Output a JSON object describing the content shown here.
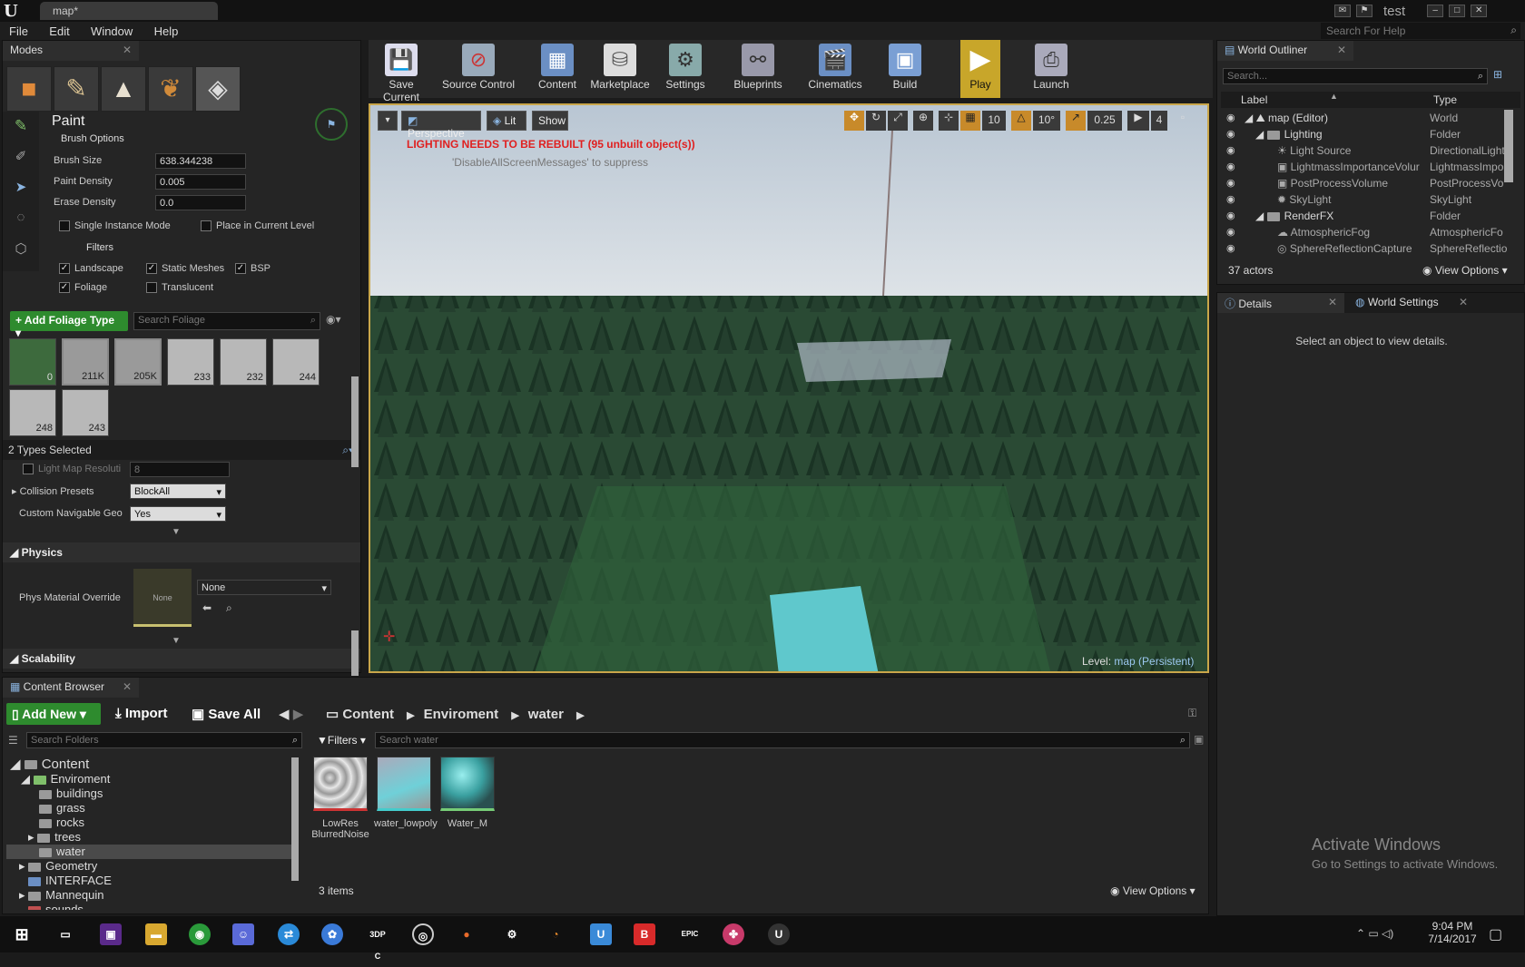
{
  "window": {
    "doc_tab": "map*",
    "user": "test",
    "help_search_placeholder": "Search For Help"
  },
  "menu": [
    "File",
    "Edit",
    "Window",
    "Help"
  ],
  "modes": {
    "tab": "Modes",
    "paint_title": "Paint",
    "brush_options": "Brush Options",
    "brush_size_label": "Brush Size",
    "brush_size": "638.344238",
    "paint_density_label": "Paint Density",
    "paint_density": "0.005",
    "erase_density_label": "Erase Density",
    "erase_density": "0.0",
    "single_instance": "Single Instance Mode",
    "place_current_level": "Place in Current Level",
    "filters": "Filters",
    "f_landscape": "Landscape",
    "f_static": "Static Meshes",
    "f_bsp": "BSP",
    "f_foliage": "Foliage",
    "f_translucent": "Translucent",
    "add_foliage": "Add Foliage Type",
    "search_foliage": "Search Foliage",
    "thumbs": [
      "0",
      "211K",
      "205K",
      "233",
      "232",
      "244",
      "248",
      "243"
    ],
    "types_selected": "2 Types Selected",
    "lightmap_label": "Light Map Resoluti",
    "lightmap_value": "8",
    "collision_label": "Collision Presets",
    "collision_value": "BlockAll",
    "navgeo_label": "Custom Navigable Geo",
    "navgeo_value": "Yes",
    "physics": "Physics",
    "phys_mat_label": "Phys Material Override",
    "phys_thumb": "None",
    "phys_value": "None",
    "scalability": "Scalability"
  },
  "toolbar": [
    "Save Current",
    "Source Control",
    "Content",
    "Marketplace",
    "Settings",
    "Blueprints",
    "Cinematics",
    "Build",
    "Play",
    "Launch"
  ],
  "viewport": {
    "perspective": "Perspective",
    "lit": "Lit",
    "show": "Show",
    "grid": "10",
    "angle": "10°",
    "scale": "0.25",
    "cam_speed": "4",
    "warning": "LIGHTING NEEDS TO BE REBUILT (95 unbuilt object(s))",
    "suppress": "'DisableAllScreenMessages' to suppress",
    "level_label": "Level:",
    "level_value": "map (Persistent)"
  },
  "outliner": {
    "tab": "World Outliner",
    "search": "Search...",
    "col_label": "Label",
    "col_type": "Type",
    "rows": [
      {
        "label": "map (Editor)",
        "type": "World"
      },
      {
        "label": "Lighting",
        "type": "Folder"
      },
      {
        "label": "Light Source",
        "type": "DirectionalLight"
      },
      {
        "label": "LightmassImportanceVolur",
        "type": "LightmassImpo"
      },
      {
        "label": "PostProcessVolume",
        "type": "PostProcessVo"
      },
      {
        "label": "SkyLight",
        "type": "SkyLight"
      },
      {
        "label": "RenderFX",
        "type": "Folder"
      },
      {
        "label": "AtmosphericFog",
        "type": "AtmosphericFo"
      },
      {
        "label": "SphereReflectionCapture",
        "type": "SphereReflectio"
      }
    ],
    "actors": "37 actors",
    "view_options": "View Options"
  },
  "details": {
    "tab": "Details",
    "tab2": "World Settings",
    "empty": "Select an object to view details."
  },
  "content_browser": {
    "tab": "Content Browser",
    "add_new": "Add New",
    "import": "Import",
    "save_all": "Save All",
    "path": [
      "Content",
      "Enviroment",
      "water"
    ],
    "search_folders": "Search Folders",
    "filters": "Filters",
    "search_assets": "Search water",
    "tree": [
      "Content",
      "Enviroment",
      "buildings",
      "grass",
      "rocks",
      "trees",
      "water",
      "Geometry",
      "INTERFACE",
      "Mannequin",
      "sounds"
    ],
    "assets": [
      {
        "name1": "LowRes",
        "name2": "BlurredNoise"
      },
      {
        "name1": "water_lowpoly",
        "name2": ""
      },
      {
        "name1": "Water_M",
        "name2": ""
      }
    ],
    "count": "3 items",
    "view_options": "View Options"
  },
  "watermark": {
    "line1": "Activate Windows",
    "line2": "Go to Settings to activate Windows."
  },
  "taskbar": {
    "time": "9:04 PM",
    "date": "7/14/2017"
  }
}
